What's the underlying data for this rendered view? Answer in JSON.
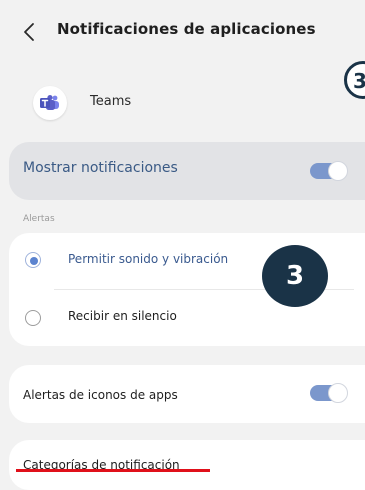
{
  "header": {
    "title": "Notificaciones de aplicaciones",
    "back_icon": "chevron-left-icon"
  },
  "annotations": {
    "edge_label": "3",
    "badge_label": "3",
    "badge_color": "#1a3347",
    "underline_color": "#e0101a"
  },
  "app": {
    "name": "Teams",
    "icon": "teams-icon",
    "brand_color": "#5b5fc7"
  },
  "main_toggle": {
    "label": "Mostrar notificaciones",
    "enabled": true,
    "accent": "#7b97cc"
  },
  "alerts": {
    "section_label": "Alertas",
    "options": [
      {
        "label": "Permitir sonido y vibración",
        "selected": true
      },
      {
        "label": "Recibir en silencio",
        "selected": false
      }
    ]
  },
  "icon_badges": {
    "label": "Alertas de iconos de apps",
    "enabled": true
  },
  "categories": {
    "label": "Categorías de notificación"
  }
}
